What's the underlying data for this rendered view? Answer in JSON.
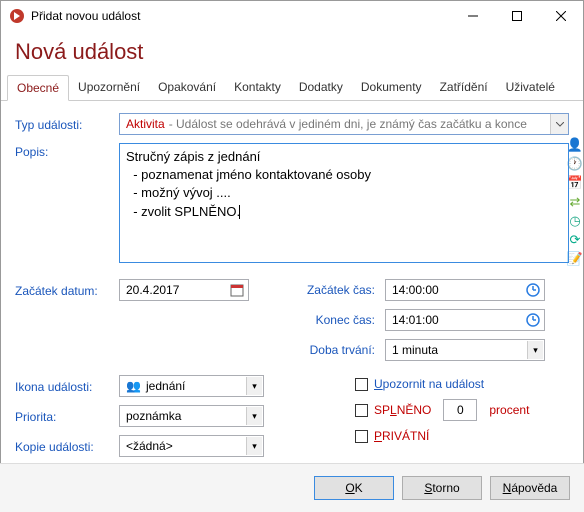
{
  "titlebar": {
    "text": "Přidat novou událost"
  },
  "heading": "Nová událost",
  "tabs": [
    {
      "label": "Obecné",
      "active": true
    },
    {
      "label": "Upozornění"
    },
    {
      "label": "Opakování"
    },
    {
      "label": "Kontakty"
    },
    {
      "label": "Dodatky"
    },
    {
      "label": "Dokumenty"
    },
    {
      "label": "Zatřídění"
    },
    {
      "label": "Uživatelé"
    }
  ],
  "labels": {
    "type": "Typ události:",
    "desc": "Popis:",
    "start_date": "Začátek datum:",
    "start_time": "Začátek čas:",
    "end_time": "Konec čas:",
    "duration": "Doba trvání:",
    "icon": "Ikona události:",
    "priority": "Priorita:",
    "copy": "Kopie události:"
  },
  "type_field": {
    "value": "Aktivita",
    "hint": "- Událost se odehrává v jediném dni, je známý čas začátku a konce"
  },
  "desc_lines": "Stručný zápis z jednání\n  - poznamenat jméno kontaktované osoby\n  - možný vývoj ....\n  - zvolit SPLNĚNO.",
  "start_date": "20.4.2017",
  "start_time": "14:00:00",
  "end_time": "14:01:00",
  "duration": "1 minuta",
  "icon_value": "jednání",
  "priority_value": "poznámka",
  "copy_value": "<žádná>",
  "checks": {
    "notify": "Upozornit na událost",
    "done": "SPLNĚNO",
    "percent_value": "0",
    "percent_label": "procent",
    "private": "PRIVÁTNÍ"
  },
  "buttons": {
    "ok": "OK",
    "cancel": "Storno",
    "help": "Nápověda"
  }
}
